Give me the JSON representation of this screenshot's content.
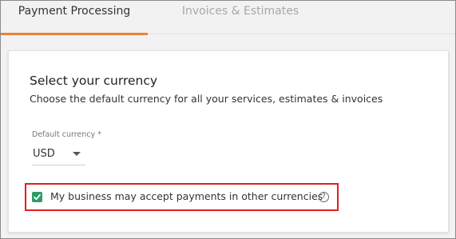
{
  "tabs": [
    {
      "label": "Payment Processing",
      "active": true
    },
    {
      "label": "Invoices & Estimates",
      "active": false
    }
  ],
  "colors": {
    "accent": "#e6823a",
    "checkbox": "#2e9b68",
    "highlight": "#e01f1f"
  },
  "currency_section": {
    "title": "Select your currency",
    "subtitle": "Choose the default currency for all your services, estimates & invoices",
    "field_label": "Default currency *",
    "selected_currency": "USD",
    "other_currencies_label": "My business may accept payments in other currencies",
    "other_currencies_checked": true,
    "help_glyph": "?"
  }
}
